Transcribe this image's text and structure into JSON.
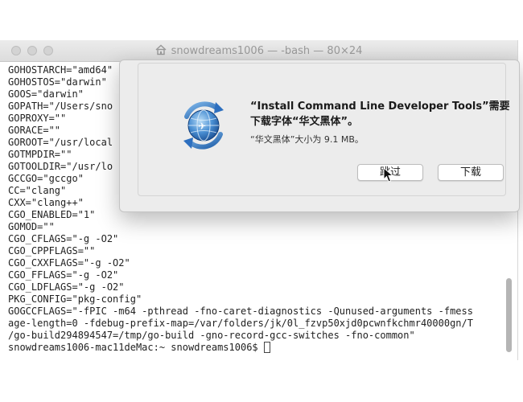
{
  "window": {
    "title": "snowdreams1006 — -bash — 80×24"
  },
  "terminal": {
    "lines": [
      "GOHOSTARCH=\"amd64\"",
      "GOHOSTOS=\"darwin\"",
      "GOOS=\"darwin\"",
      "GOPATH=\"/Users/sno",
      "GOPROXY=\"\"",
      "GORACE=\"\"",
      "GOROOT=\"/usr/local",
      "GOTMPDIR=\"\"",
      "GOTOOLDIR=\"/usr/lo",
      "GCCGO=\"gccgo\"",
      "CC=\"clang\"",
      "CXX=\"clang++\"",
      "CGO_ENABLED=\"1\"",
      "GOMOD=\"\"",
      "CGO_CFLAGS=\"-g -O2\"",
      "CGO_CPPFLAGS=\"\"",
      "CGO_CXXFLAGS=\"-g -O2\"",
      "CGO_FFLAGS=\"-g -O2\"",
      "CGO_LDFLAGS=\"-g -O2\"",
      "PKG_CONFIG=\"pkg-config\"",
      "GOGCCFLAGS=\"-fPIC -m64 -pthread -fno-caret-diagnostics -Qunused-arguments -fmess",
      "age-length=0 -fdebug-prefix-map=/var/folders/jk/0l_fzvp50xjd0pcwnfkchmr40000gn/T",
      "/go-build294894547=/tmp/go-build -gno-record-gcc-switches -fno-common\""
    ],
    "prompt": "snowdreams1006-mac11deMac:~ snowdreams1006$ "
  },
  "dialog": {
    "title": "“Install Command Line Developer Tools”需要下载字体“华文黑体”。",
    "message": "“华文黑体”大小为 9.1 MB。",
    "skip_label": "跳过",
    "download_label": "下载"
  }
}
